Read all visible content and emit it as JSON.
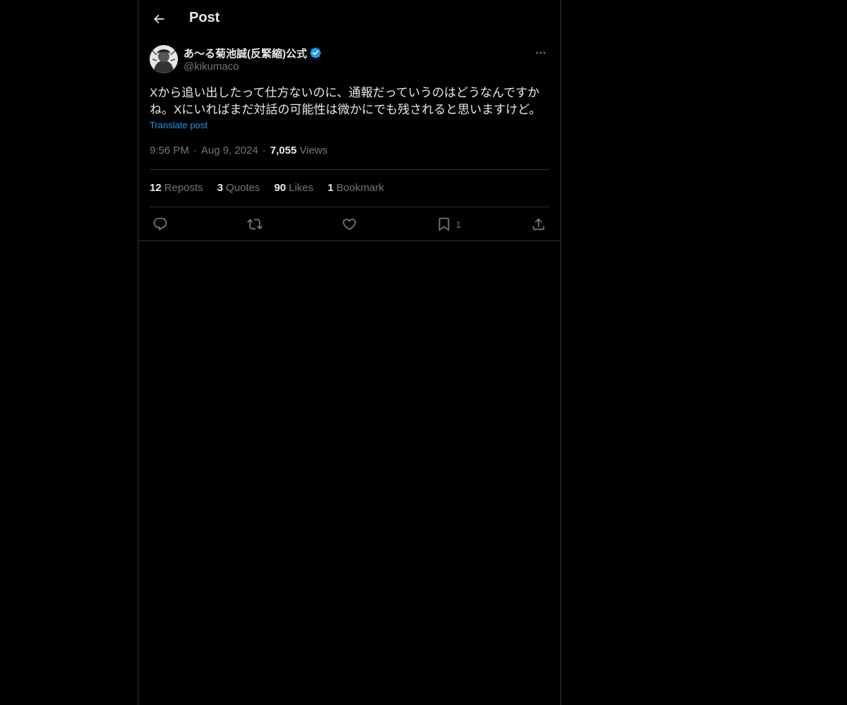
{
  "header": {
    "title": "Post",
    "back_icon": "arrow-left-icon"
  },
  "post": {
    "author": {
      "name": "あ〜る菊池誠(反緊縮)公式",
      "handle": "@kikumaco",
      "verified": true,
      "verified_color": "#1d9bf0"
    },
    "text": "Xから追い出したって仕方ないのに、通報だっていうのはどうなんですかね。Xにいればまだ対話の可能性は微かにでも残されると思いますけど。",
    "translate_label": "Translate post",
    "time": "9:56 PM",
    "date": "Aug 9, 2024",
    "views_count": "7,055",
    "views_label": "Views",
    "stats": [
      {
        "count": "12",
        "label": "Reposts"
      },
      {
        "count": "3",
        "label": "Quotes"
      },
      {
        "count": "90",
        "label": "Likes"
      },
      {
        "count": "1",
        "label": "Bookmark"
      }
    ],
    "actions": {
      "reply_icon": "reply-icon",
      "repost_icon": "repost-icon",
      "like_icon": "heart-icon",
      "bookmark_icon": "bookmark-icon",
      "bookmark_count": "1",
      "share_icon": "share-icon"
    }
  },
  "colors": {
    "background": "#000000",
    "text_primary": "#e7e9ea",
    "text_secondary": "#71767b",
    "accent": "#1d9bf0",
    "border": "#2f3336"
  }
}
